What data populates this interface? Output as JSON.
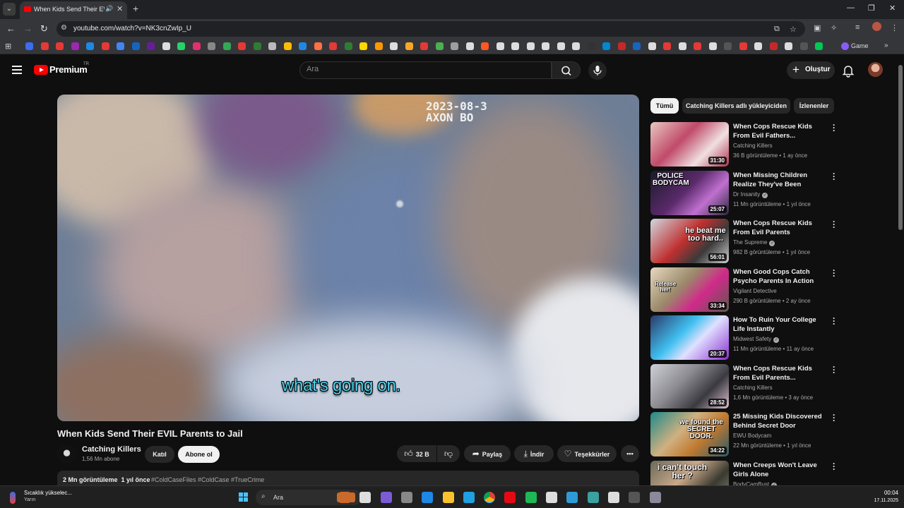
{
  "browser": {
    "tab_title": "When Kids Send Their EVIL Parents to Jail",
    "url": "youtube.com/watch?v=NK3cnZwIp_U",
    "bookmark_game_label": "Game"
  },
  "header": {
    "logo_text": "Premium",
    "logo_region": "TR",
    "search_placeholder": "Ara",
    "create_label": "Oluştur"
  },
  "player": {
    "timestamp_line1": "2023-08-3",
    "timestamp_line2": "AXON BO",
    "caption": "what's going on."
  },
  "video": {
    "title": "When Kids Send Their EVIL Parents to Jail",
    "channel_name": "Catching Killers",
    "subscribers": "1,56 Mn abone",
    "join_label": "Katıl",
    "subscribe_label": "Abone ol",
    "like_count": "32 B",
    "share_label": "Paylaş",
    "download_label": "İndir",
    "thanks_label": "Teşekkürler",
    "views": "2 Mn görüntüleme",
    "age": "1 yıl önce",
    "hashtags": "#ColdCaseFiles #ColdCase #TrueCrime"
  },
  "sidebar": {
    "chips": [
      "Tümü",
      "Catching Killers adlı yükleyiciden",
      "İzlenenler"
    ],
    "recommendations": [
      {
        "title": "When Cops Rescue Kids From Evil Fathers...",
        "channel": "Catching Killers",
        "verified": false,
        "meta": "36 B görüntüleme • 1 ay önce",
        "duration": "31:30",
        "overlay": ""
      },
      {
        "title": "When Missing Children Realize They've Been Rescued",
        "channel": "Dr Insanity",
        "verified": true,
        "meta": "11 Mn görüntüleme • 1 yıl önce",
        "duration": "25:07",
        "overlay": "POLICE BODYCAM"
      },
      {
        "title": "When Cops Rescue Kids From Evil Parents",
        "channel": "The Supreme",
        "verified": true,
        "meta": "982 B görüntüleme • 1 yıl önce",
        "duration": "56:01",
        "overlay": "he beat me too hard.."
      },
      {
        "title": "When Good Cops Catch Psycho Parents In Action",
        "channel": "Vigilant Detective",
        "verified": false,
        "meta": "290 B görüntüleme • 2 ay önce",
        "duration": "33:34",
        "overlay": "Release her!"
      },
      {
        "title": "How To Ruin Your College Life Instantly",
        "channel": "Midwest Safety",
        "verified": true,
        "meta": "11 Mn görüntüleme • 11 ay önce",
        "duration": "20:37",
        "overlay": ""
      },
      {
        "title": "When Cops Rescue Kids From Evil Parents...",
        "channel": "Catching Killers",
        "verified": false,
        "meta": "1,6 Mn görüntüleme • 3 ay önce",
        "duration": "28:52",
        "overlay": ""
      },
      {
        "title": "25 Missing Kids Discovered Behind Secret Door",
        "channel": "EWU Bodycam",
        "verified": false,
        "meta": "22 Mn görüntüleme • 1 yıl önce",
        "duration": "34:22",
        "overlay": "we found the SECRET DOOR."
      },
      {
        "title": "When Creeps Won't Leave Girls Alone",
        "channel": "BodyCamBust",
        "verified": true,
        "meta": "",
        "duration": "",
        "overlay": "i can't touch her ?"
      }
    ]
  },
  "taskbar": {
    "weather_title": "Sıcaklık yükselec...",
    "weather_sub": "Yarın",
    "search_label": "Ara",
    "time": "00:04",
    "date": "17.11.2025"
  },
  "colors": {
    "accent": "#ff0000",
    "caption": "#4fd3f0",
    "background": "#0f0f0f"
  }
}
